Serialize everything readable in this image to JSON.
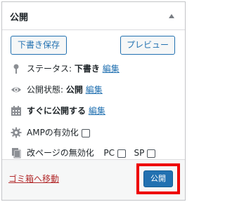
{
  "panel": {
    "title": "公開"
  },
  "actions": {
    "draft_label": "下書き保存",
    "preview_label": "プレビュー"
  },
  "status": {
    "label": "ステータス:",
    "value": "下書き",
    "edit": "編集"
  },
  "visibility": {
    "label": "公開状態:",
    "value": "公開",
    "edit": "編集"
  },
  "schedule": {
    "label": "すぐに公開する",
    "edit": "編集"
  },
  "amp": {
    "label": "AMPの有効化",
    "checked": false
  },
  "page_break": {
    "label": "改ページの無効化",
    "pc_label": "PC",
    "sp_label": "SP",
    "pc_checked": false,
    "sp_checked": false
  },
  "footer": {
    "trash_label": "ゴミ箱へ移動",
    "publish_label": "公開"
  },
  "colors": {
    "accent": "#2271b1",
    "danger": "#b32d2e",
    "highlight": "#ee0000"
  }
}
